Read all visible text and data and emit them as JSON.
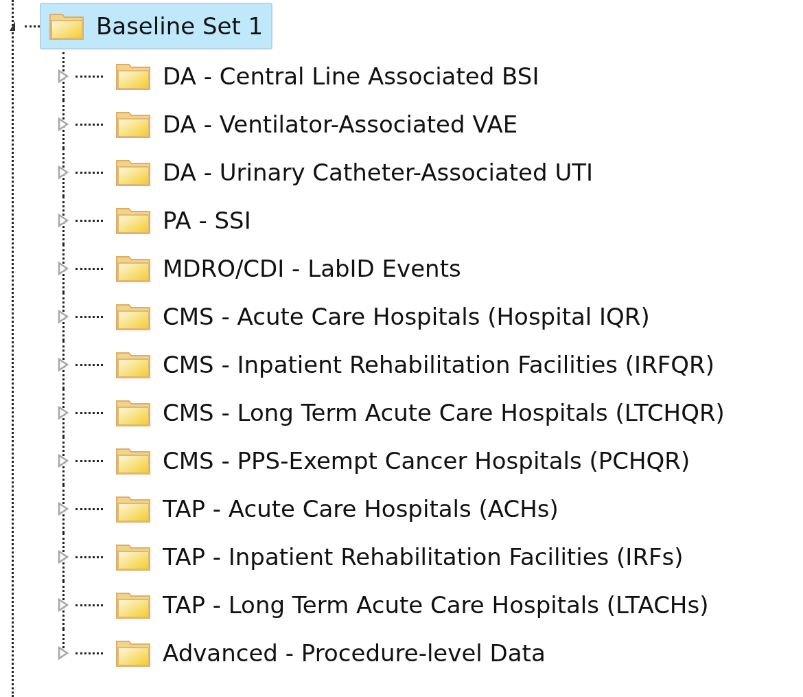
{
  "tree": {
    "label": "Baseline Set 1",
    "expanded": true,
    "selected": true,
    "children": [
      {
        "label": "DA - Central Line Associated BSI",
        "expanded": false,
        "selected": false
      },
      {
        "label": "DA - Ventilator-Associated VAE",
        "expanded": false,
        "selected": false
      },
      {
        "label": "DA - Urinary Catheter-Associated UTI",
        "expanded": false,
        "selected": false
      },
      {
        "label": "PA - SSI",
        "expanded": false,
        "selected": false
      },
      {
        "label": "MDRO/CDI - LabID Events",
        "expanded": false,
        "selected": false
      },
      {
        "label": "CMS - Acute Care Hospitals (Hospital IQR)",
        "expanded": false,
        "selected": false
      },
      {
        "label": "CMS - Inpatient Rehabilitation Facilities (IRFQR)",
        "expanded": false,
        "selected": false
      },
      {
        "label": "CMS - Long Term Acute Care Hospitals (LTCHQR)",
        "expanded": false,
        "selected": false
      },
      {
        "label": "CMS - PPS-Exempt Cancer Hospitals (PCHQR)",
        "expanded": false,
        "selected": false
      },
      {
        "label": "TAP - Acute Care Hospitals (ACHs)",
        "expanded": false,
        "selected": false
      },
      {
        "label": "TAP - Inpatient Rehabilitation Facilities (IRFs)",
        "expanded": false,
        "selected": false
      },
      {
        "label": "TAP - Long Term Acute Care Hospitals (LTACHs)",
        "expanded": false,
        "selected": false
      },
      {
        "label": "Advanced - Procedure-level Data",
        "expanded": false,
        "selected": false
      }
    ]
  }
}
